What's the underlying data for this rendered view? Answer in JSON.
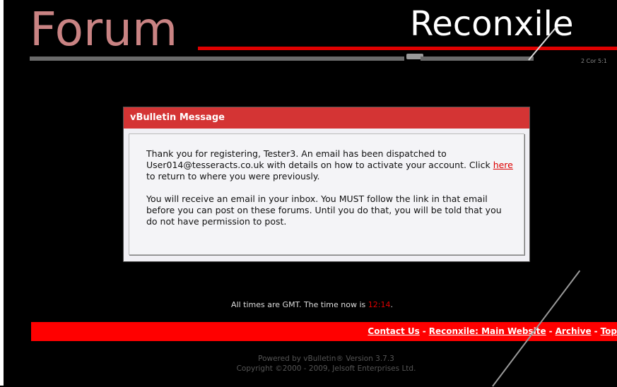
{
  "header": {
    "logo_forum": "Forum",
    "logo_site": "Reconxile",
    "verse": "2 Cor 5:1"
  },
  "message": {
    "title": "vBulletin Message",
    "p1_before": "Thank you for registering, Tester3. An email has been dispatched to User014@tesseracts.co.uk with details on how to activate your account. Click ",
    "p1_link": "here",
    "p1_after": " to return to where you were previously.",
    "p2": "You will receive an email in your inbox. You MUST follow the link in that email before you can post on these forums. Until you do that, you will be told that you do not have permission to post."
  },
  "timeline": {
    "prefix": "All times are GMT. The time now is ",
    "time": "12:14",
    "suffix": "."
  },
  "footer": {
    "links": [
      "Contact Us",
      "Reconxile: Main Website",
      "Archive",
      "Top"
    ],
    "separator": "-"
  },
  "powered": {
    "line1": "Powered by vBulletin® Version 3.7.3",
    "line2": "Copyright ©2000 - 2009, Jelsoft Enterprises Ltd."
  },
  "colors": {
    "accent_red": "#ff0000",
    "title_red": "#d43434",
    "forum_logo": "#c98383"
  }
}
